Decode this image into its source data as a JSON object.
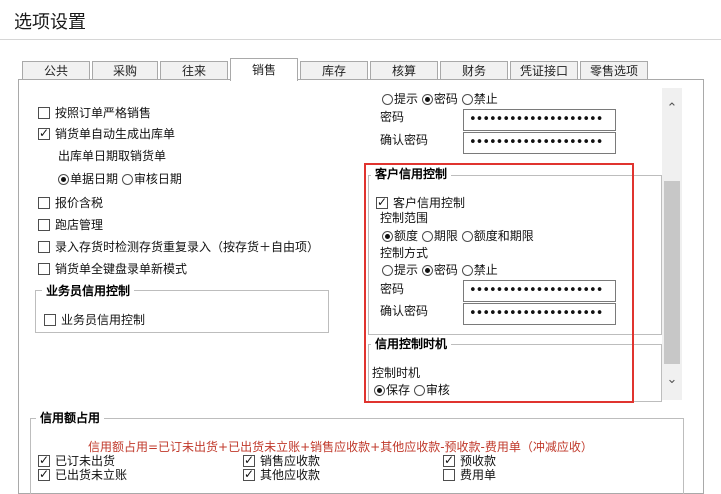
{
  "window": {
    "title": "选项设置"
  },
  "tabs": [
    {
      "label": "公共"
    },
    {
      "label": "采购"
    },
    {
      "label": "往来"
    },
    {
      "label": "销售"
    },
    {
      "label": "库存"
    },
    {
      "label": "核算"
    },
    {
      "label": "财务"
    },
    {
      "label": "凭证接口"
    },
    {
      "label": "零售选项"
    }
  ],
  "active_tab": "销售",
  "left_options": {
    "strict_sales": "按照订单严格销售",
    "auto_outbound": "销货单自动生成出库单",
    "outbound_date_label": "出库单日期取销货单",
    "date_bill": "单据日期",
    "date_audit": "审核日期",
    "price_with_tax": "报价含税",
    "store_manage": "跑店管理",
    "check_duplicate": "录入存货时检测存货重复录入（按存货＋自由项）",
    "keyboard_mode": "销货单全键盘录单新模式"
  },
  "salesman_credit": {
    "group_title": "业务员信用控制",
    "checkbox": "业务员信用控制"
  },
  "top_right": {
    "mode_prompt": "提示",
    "mode_password": "密码",
    "mode_forbid": "禁止",
    "password_label": "密码",
    "confirm_label": "确认密码",
    "password_value": "••••••••••••••••••••",
    "confirm_value": "••••••••••••••••••••"
  },
  "customer_credit": {
    "group_title": "客户信用控制",
    "checkbox": "客户信用控制",
    "range_label": "控制范围",
    "range_amount": "额度",
    "range_term": "期限",
    "range_both": "额度和期限",
    "method_label": "控制方式",
    "method_prompt": "提示",
    "method_password": "密码",
    "method_forbid": "禁止",
    "password_label": "密码",
    "confirm_label": "确认密码",
    "password_value": "••••••••••••••••••••",
    "confirm_value": "••••••••••••••••••••"
  },
  "credit_timing": {
    "group_title": "信用控制时机",
    "label": "控制时机",
    "save": "保存",
    "audit": "审核"
  },
  "credit_usage": {
    "group_title": "信用额占用",
    "formula": "信用额占用=已订未出货+已出货未立账+销售应收款+其他应收款-预收款-费用单（冲减应收）",
    "items": {
      "ordered_not_shipped": "已订未出货",
      "shipped_not_billed": "已出货未立账",
      "sales_receivable": "销售应收款",
      "other_receivable": "其他应收款",
      "advance_receipt": "预收款",
      "expense_bill": "费用单"
    }
  },
  "colors": {
    "highlight_border": "#e0342f",
    "formula_text": "#c0392b"
  }
}
